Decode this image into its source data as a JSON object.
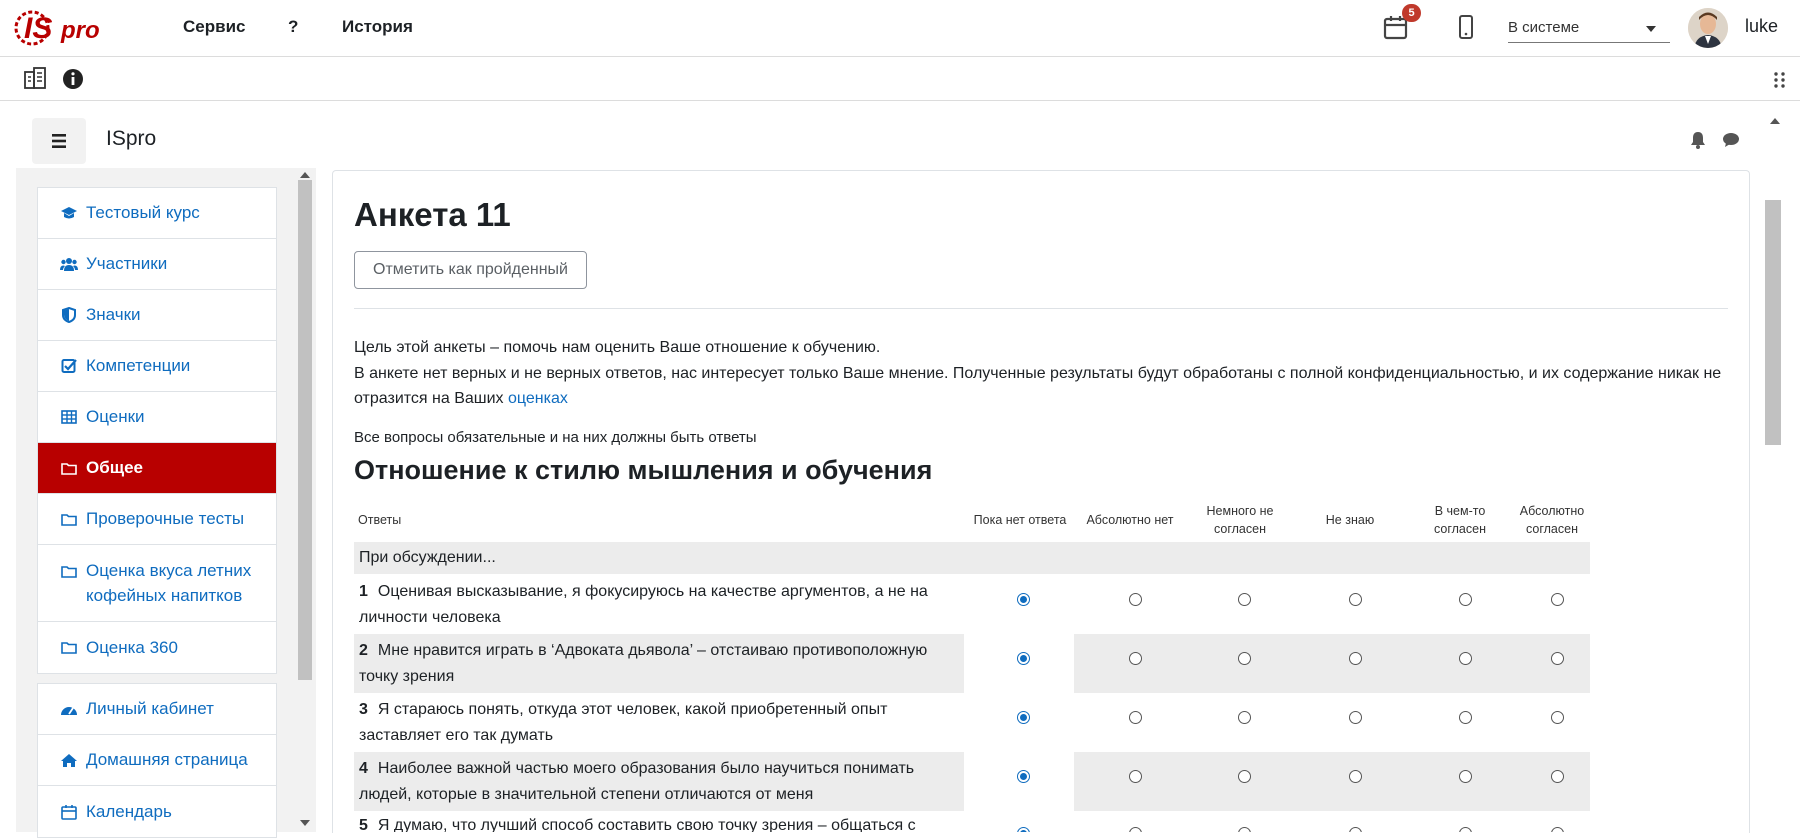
{
  "app": {
    "logo_text": "ISpro",
    "brand_color": "#b80000",
    "link_color": "#0f6cbf"
  },
  "topnav": [
    {
      "label": "Сервис"
    },
    {
      "label": "?"
    },
    {
      "label": "История"
    }
  ],
  "header": {
    "notifications_count": "5",
    "status_select": "В системе",
    "username": "luke"
  },
  "site": {
    "title": "ISpro"
  },
  "nav": {
    "group1": [
      {
        "label": "Тестовый курс",
        "icon": "graduation-cap-icon"
      },
      {
        "label": "Участники",
        "icon": "users-icon"
      },
      {
        "label": "Значки",
        "icon": "shield-icon"
      },
      {
        "label": "Компетенции",
        "icon": "checkbox-icon"
      },
      {
        "label": "Оценки",
        "icon": "table-icon"
      },
      {
        "label": "Общее",
        "icon": "folder-icon",
        "active": true
      },
      {
        "label": "Проверочные тесты",
        "icon": "folder-icon"
      },
      {
        "label": "Оценка вкуса летних кофейных напитков",
        "icon": "folder-icon"
      },
      {
        "label": "Оценка 360",
        "icon": "folder-icon"
      }
    ],
    "group2": [
      {
        "label": "Личный кабинет",
        "icon": "dashboard-icon"
      },
      {
        "label": "Домашняя страница",
        "icon": "home-icon"
      },
      {
        "label": "Календарь",
        "icon": "calendar-icon"
      }
    ]
  },
  "main": {
    "title": "Анкета 11",
    "mark_done_button": "Отметить как пройденный",
    "intro_line1": "Цель этой анкеты – помочь нам оценить Ваше отношение к обучению.",
    "intro_line2": "В анкете нет верных и не верных ответов, нас интересует только Ваше мнение. Полученные результаты будут обработаны с полной конфиденциальностью, и их содержание никак не отразится на Ваших",
    "intro_link": "оценках",
    "required_note": "Все вопросы обязательные и на них должны быть ответы",
    "section_title": "Отношение к стилю мышления и обучения"
  },
  "table": {
    "col_answers": "Ответы",
    "options": [
      {
        "label": "Пока нет ответа"
      },
      {
        "label": "Абсолютно нет"
      },
      {
        "label": "Немного не согласен"
      },
      {
        "label": "Не знаю"
      },
      {
        "label": "В чем-то согласен"
      },
      {
        "label": "Абсолютно согласен"
      }
    ],
    "group_label": "При обсуждении...",
    "questions": [
      {
        "num": "1",
        "text": "Оценивая высказывание, я фокусируюсь на качестве аргументов, а не на личности человека",
        "selected": 0
      },
      {
        "num": "2",
        "text": "Мне нравится играть в ‘Адвоката дьявола’ – отстаиваю противоположную точку зрения",
        "selected": 0
      },
      {
        "num": "3",
        "text": "Я стараюсь понять, откуда этот человек, какой приобретенный опыт заставляет его так думать",
        "selected": 0
      },
      {
        "num": "4",
        "text": "Наиболее важной частью моего образования было научиться понимать людей, которые в значительной степени отличаются от меня",
        "selected": 0
      },
      {
        "num": "5",
        "text": "Я думаю, что лучший способ составить свою точку зрения – общаться с",
        "selected": 0
      }
    ]
  }
}
